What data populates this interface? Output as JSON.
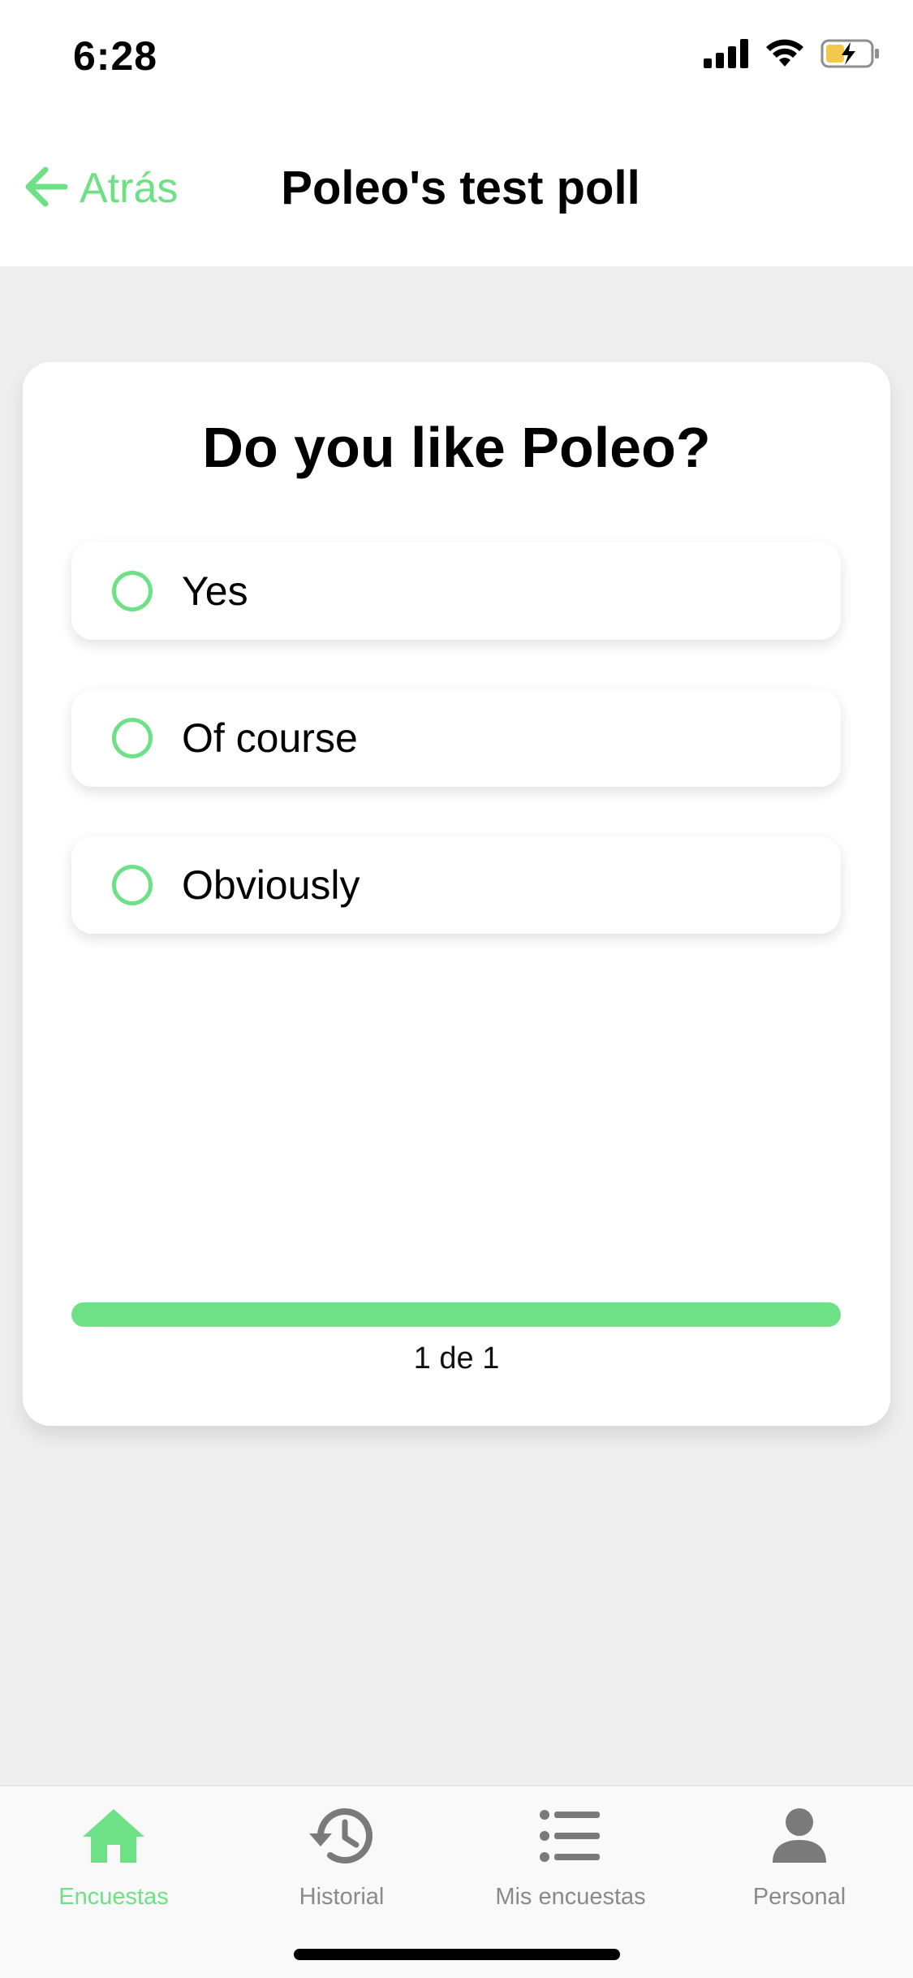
{
  "status_bar": {
    "time": "6:28",
    "icons": [
      "signal-icon",
      "wifi-icon",
      "battery-charging-icon"
    ]
  },
  "header": {
    "back_label": "Atrás",
    "title": "Poleo's test poll"
  },
  "poll": {
    "question": "Do you like Poleo?",
    "options": [
      {
        "label": "Yes",
        "selected": false
      },
      {
        "label": "Of course",
        "selected": false
      },
      {
        "label": "Obviously",
        "selected": false
      }
    ],
    "progress": {
      "current": 1,
      "total": 1,
      "text": "1 de 1"
    }
  },
  "tab_bar": {
    "tabs": [
      {
        "label": "Encuestas",
        "icon": "home-icon",
        "active": true
      },
      {
        "label": "Historial",
        "icon": "history-icon",
        "active": false
      },
      {
        "label": "Mis encuestas",
        "icon": "list-icon",
        "active": false
      },
      {
        "label": "Personal",
        "icon": "person-icon",
        "active": false
      }
    ]
  },
  "colors": {
    "accent": "#6ee086",
    "background": "#efefef",
    "inactive": "#7a7a7a"
  }
}
